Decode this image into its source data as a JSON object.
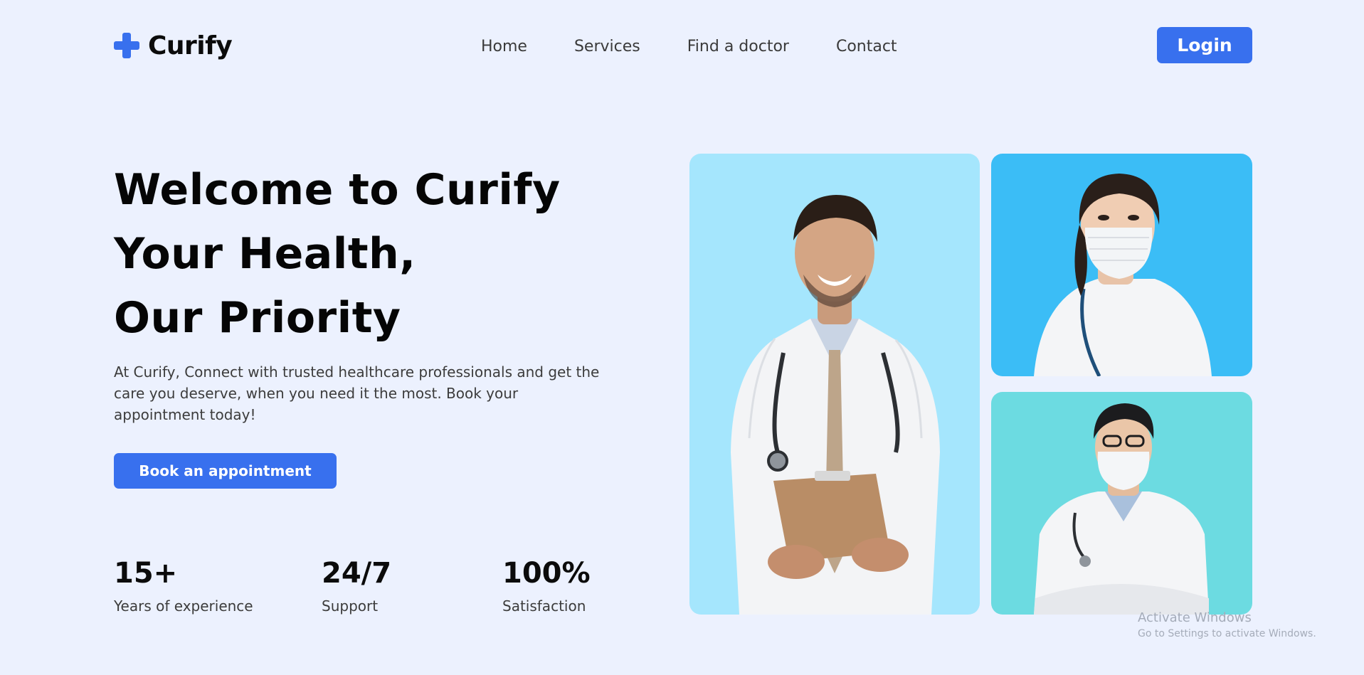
{
  "brand": {
    "name": "Curify",
    "icon": "medical-cross-icon",
    "accent": "#3870ee"
  },
  "nav": [
    {
      "label": "Home"
    },
    {
      "label": "Services"
    },
    {
      "label": "Find a doctor"
    },
    {
      "label": "Contact"
    }
  ],
  "header": {
    "login_label": "Login"
  },
  "hero": {
    "title_lines": [
      "Welcome to Curify",
      "Your Health,",
      "Our Priority"
    ],
    "description": "At Curify, Connect with trusted healthcare professionals and get the care you deserve, when you need it the most. Book your appointment today!",
    "cta_label": "Book an appointment"
  },
  "stats": [
    {
      "value": "15+",
      "label": "Years of experience"
    },
    {
      "value": "24/7",
      "label": "Support"
    },
    {
      "value": "100%",
      "label": "Satisfaction"
    }
  ],
  "photos": {
    "main": {
      "bg": "#a5e6fd"
    },
    "top": {
      "bg": "#3bbdf6"
    },
    "bottom": {
      "bg": "#6cdbe1"
    }
  },
  "watermark": {
    "line1": "Activate Windows",
    "line2": "Go to Settings to activate Windows."
  }
}
